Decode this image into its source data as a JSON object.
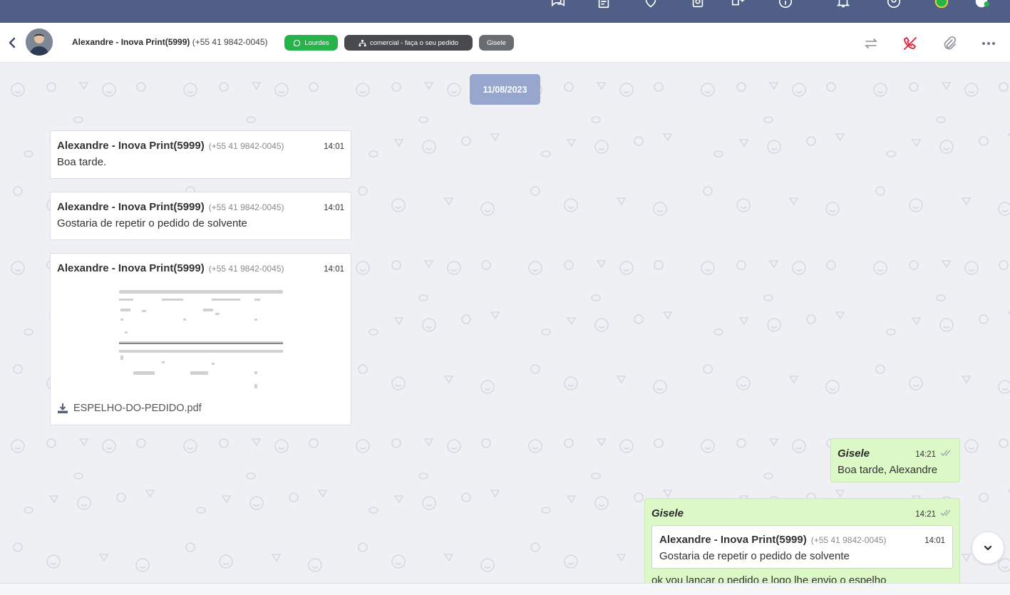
{
  "header": {
    "contact_name": "Alexandre - Inova Print(5999)",
    "contact_phone": "(+55 41 9842-0045)",
    "badge_whatsapp": "Lourdes",
    "badge_department": "comercial - faça o seu pedido",
    "badge_agent": "Gisele"
  },
  "chat": {
    "date": "11/08/2023",
    "incoming": [
      {
        "sender": "Alexandre - Inova Print(5999)",
        "phone": "(+55 41 9842-0045)",
        "time": "14:01",
        "text": "Boa tarde."
      },
      {
        "sender": "Alexandre - Inova Print(5999)",
        "phone": "(+55 41 9842-0045)",
        "time": "14:01",
        "text": "Gostaria de repetir o pedido de solvente"
      },
      {
        "sender": "Alexandre - Inova Print(5999)",
        "phone": "(+55 41 9842-0045)",
        "time": "14:01",
        "file_name": "ESPELHO-DO-PEDIDO.pdf"
      }
    ],
    "outgoing": [
      {
        "sender": "Gisele",
        "time": "14:21",
        "text": "Boa tarde, Alexandre"
      },
      {
        "sender": "Gisele",
        "time": "14:21",
        "quote": {
          "sender": "Alexandre - Inova Print(5999)",
          "phone": "(+55 41 9842-0045)",
          "time": "14:01",
          "text": "Gostaria de repetir o pedido de solvente"
        },
        "text": "ok vou lançar o pedido e logo lhe envio o espelho"
      }
    ]
  },
  "colors": {
    "topbar": "#4f5f87",
    "date_pill": "#97a6cc",
    "outgoing_bubble": "#dcf8c6",
    "badge_green": "#25b34a",
    "badge_dark": "#484a4d",
    "badge_gray": "#6a6d70",
    "call_end_red": "#d9213a"
  }
}
